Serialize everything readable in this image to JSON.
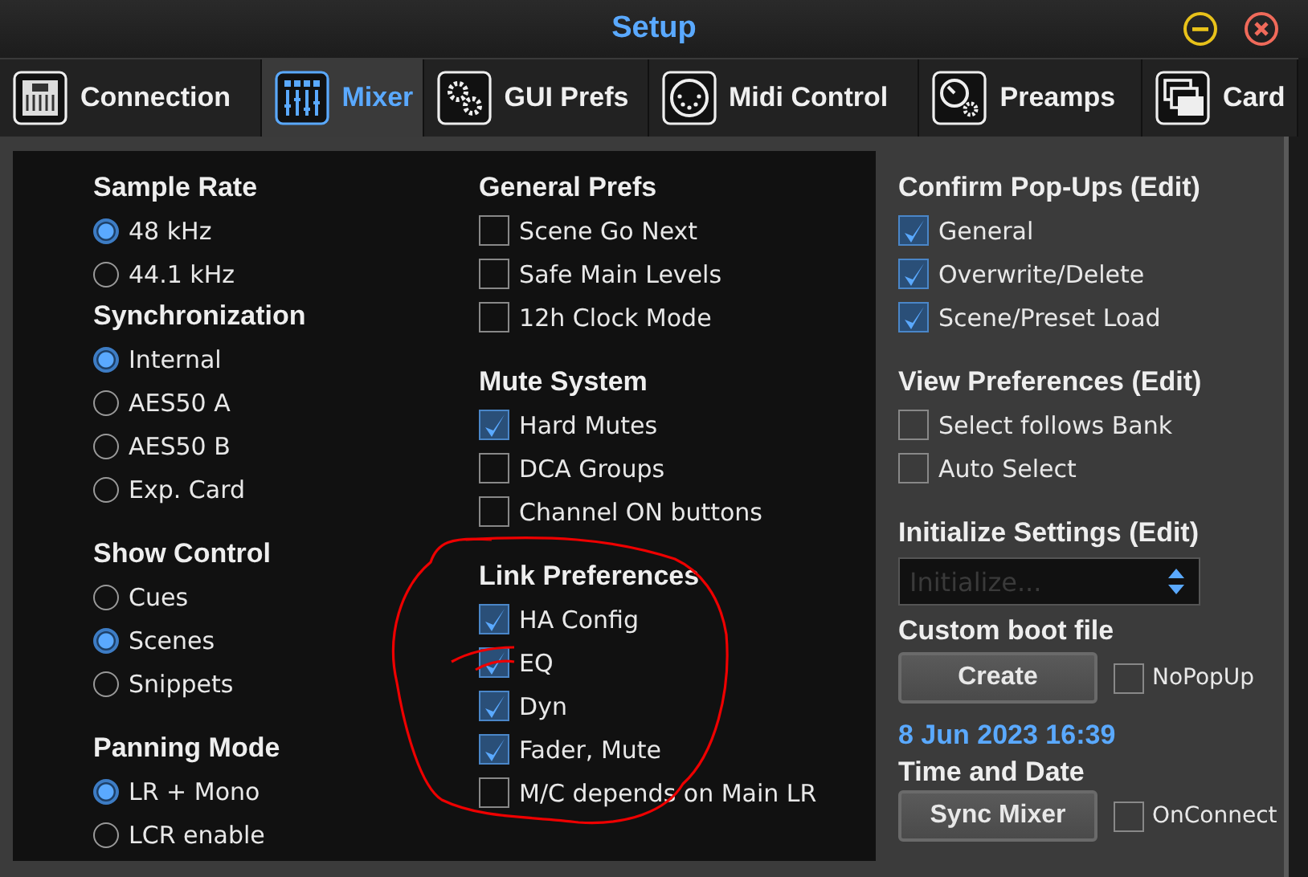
{
  "window": {
    "title": "Setup"
  },
  "tabs": [
    {
      "label": "Connection",
      "selected": false
    },
    {
      "label": "Mixer",
      "selected": true
    },
    {
      "label": "GUI Prefs",
      "selected": false
    },
    {
      "label": "Midi Control",
      "selected": false
    },
    {
      "label": "Preamps",
      "selected": false
    },
    {
      "label": "Card",
      "selected": false
    }
  ],
  "left_column": [
    {
      "title": "Sample Rate",
      "options": [
        {
          "label": "48 kHz",
          "selected": true
        },
        {
          "label": "44.1 kHz",
          "selected": false
        }
      ]
    },
    {
      "title": "Synchronization",
      "options": [
        {
          "label": "Internal",
          "selected": true
        },
        {
          "label": "AES50 A",
          "selected": false
        },
        {
          "label": "AES50 B",
          "selected": false
        },
        {
          "label": "Exp. Card",
          "selected": false
        }
      ]
    },
    {
      "title": "Show Control",
      "options": [
        {
          "label": "Cues",
          "selected": false
        },
        {
          "label": "Scenes",
          "selected": true
        },
        {
          "label": "Snippets",
          "selected": false
        }
      ]
    },
    {
      "title": "Panning Mode",
      "options": [
        {
          "label": "LR + Mono",
          "selected": true
        },
        {
          "label": "LCR enable",
          "selected": false
        }
      ]
    }
  ],
  "middle_column": [
    {
      "title": "General Prefs",
      "options": [
        {
          "label": "Scene Go Next",
          "checked": false
        },
        {
          "label": "Safe Main Levels",
          "checked": false
        },
        {
          "label": "12h Clock Mode",
          "checked": false
        }
      ]
    },
    {
      "title": "Mute System",
      "options": [
        {
          "label": "Hard Mutes",
          "checked": true
        },
        {
          "label": "DCA Groups",
          "checked": false
        },
        {
          "label": "Channel ON buttons",
          "checked": false
        }
      ]
    },
    {
      "title": "Link Preferences",
      "options": [
        {
          "label": "HA Config",
          "checked": true
        },
        {
          "label": "EQ",
          "checked": true
        },
        {
          "label": "Dyn",
          "checked": true
        },
        {
          "label": "Fader, Mute",
          "checked": true
        },
        {
          "label": "M/C depends on Main LR",
          "checked": false
        }
      ]
    }
  ],
  "right_column": {
    "confirm_popups": {
      "title": "Confirm Pop-Ups (Edit)",
      "options": [
        {
          "label": "General",
          "checked": true
        },
        {
          "label": "Overwrite/Delete",
          "checked": true
        },
        {
          "label": "Scene/Preset Load",
          "checked": true
        }
      ]
    },
    "view_preferences": {
      "title": "View Preferences (Edit)",
      "options": [
        {
          "label": "Select follows Bank",
          "checked": false
        },
        {
          "label": "Auto Select",
          "checked": false
        }
      ]
    },
    "initialize_settings": {
      "title": "Initialize Settings (Edit)",
      "placeholder": "Initialize..."
    },
    "custom_boot_file": {
      "title": "Custom boot file",
      "button": "Create",
      "checkbox": {
        "label": "NoPopUp",
        "checked": false
      }
    },
    "time_and_date": {
      "date": "8 Jun 2023 16:39",
      "title": "Time and Date",
      "button": "Sync Mixer",
      "checkbox": {
        "label": "OnConnect",
        "checked": false
      }
    }
  }
}
